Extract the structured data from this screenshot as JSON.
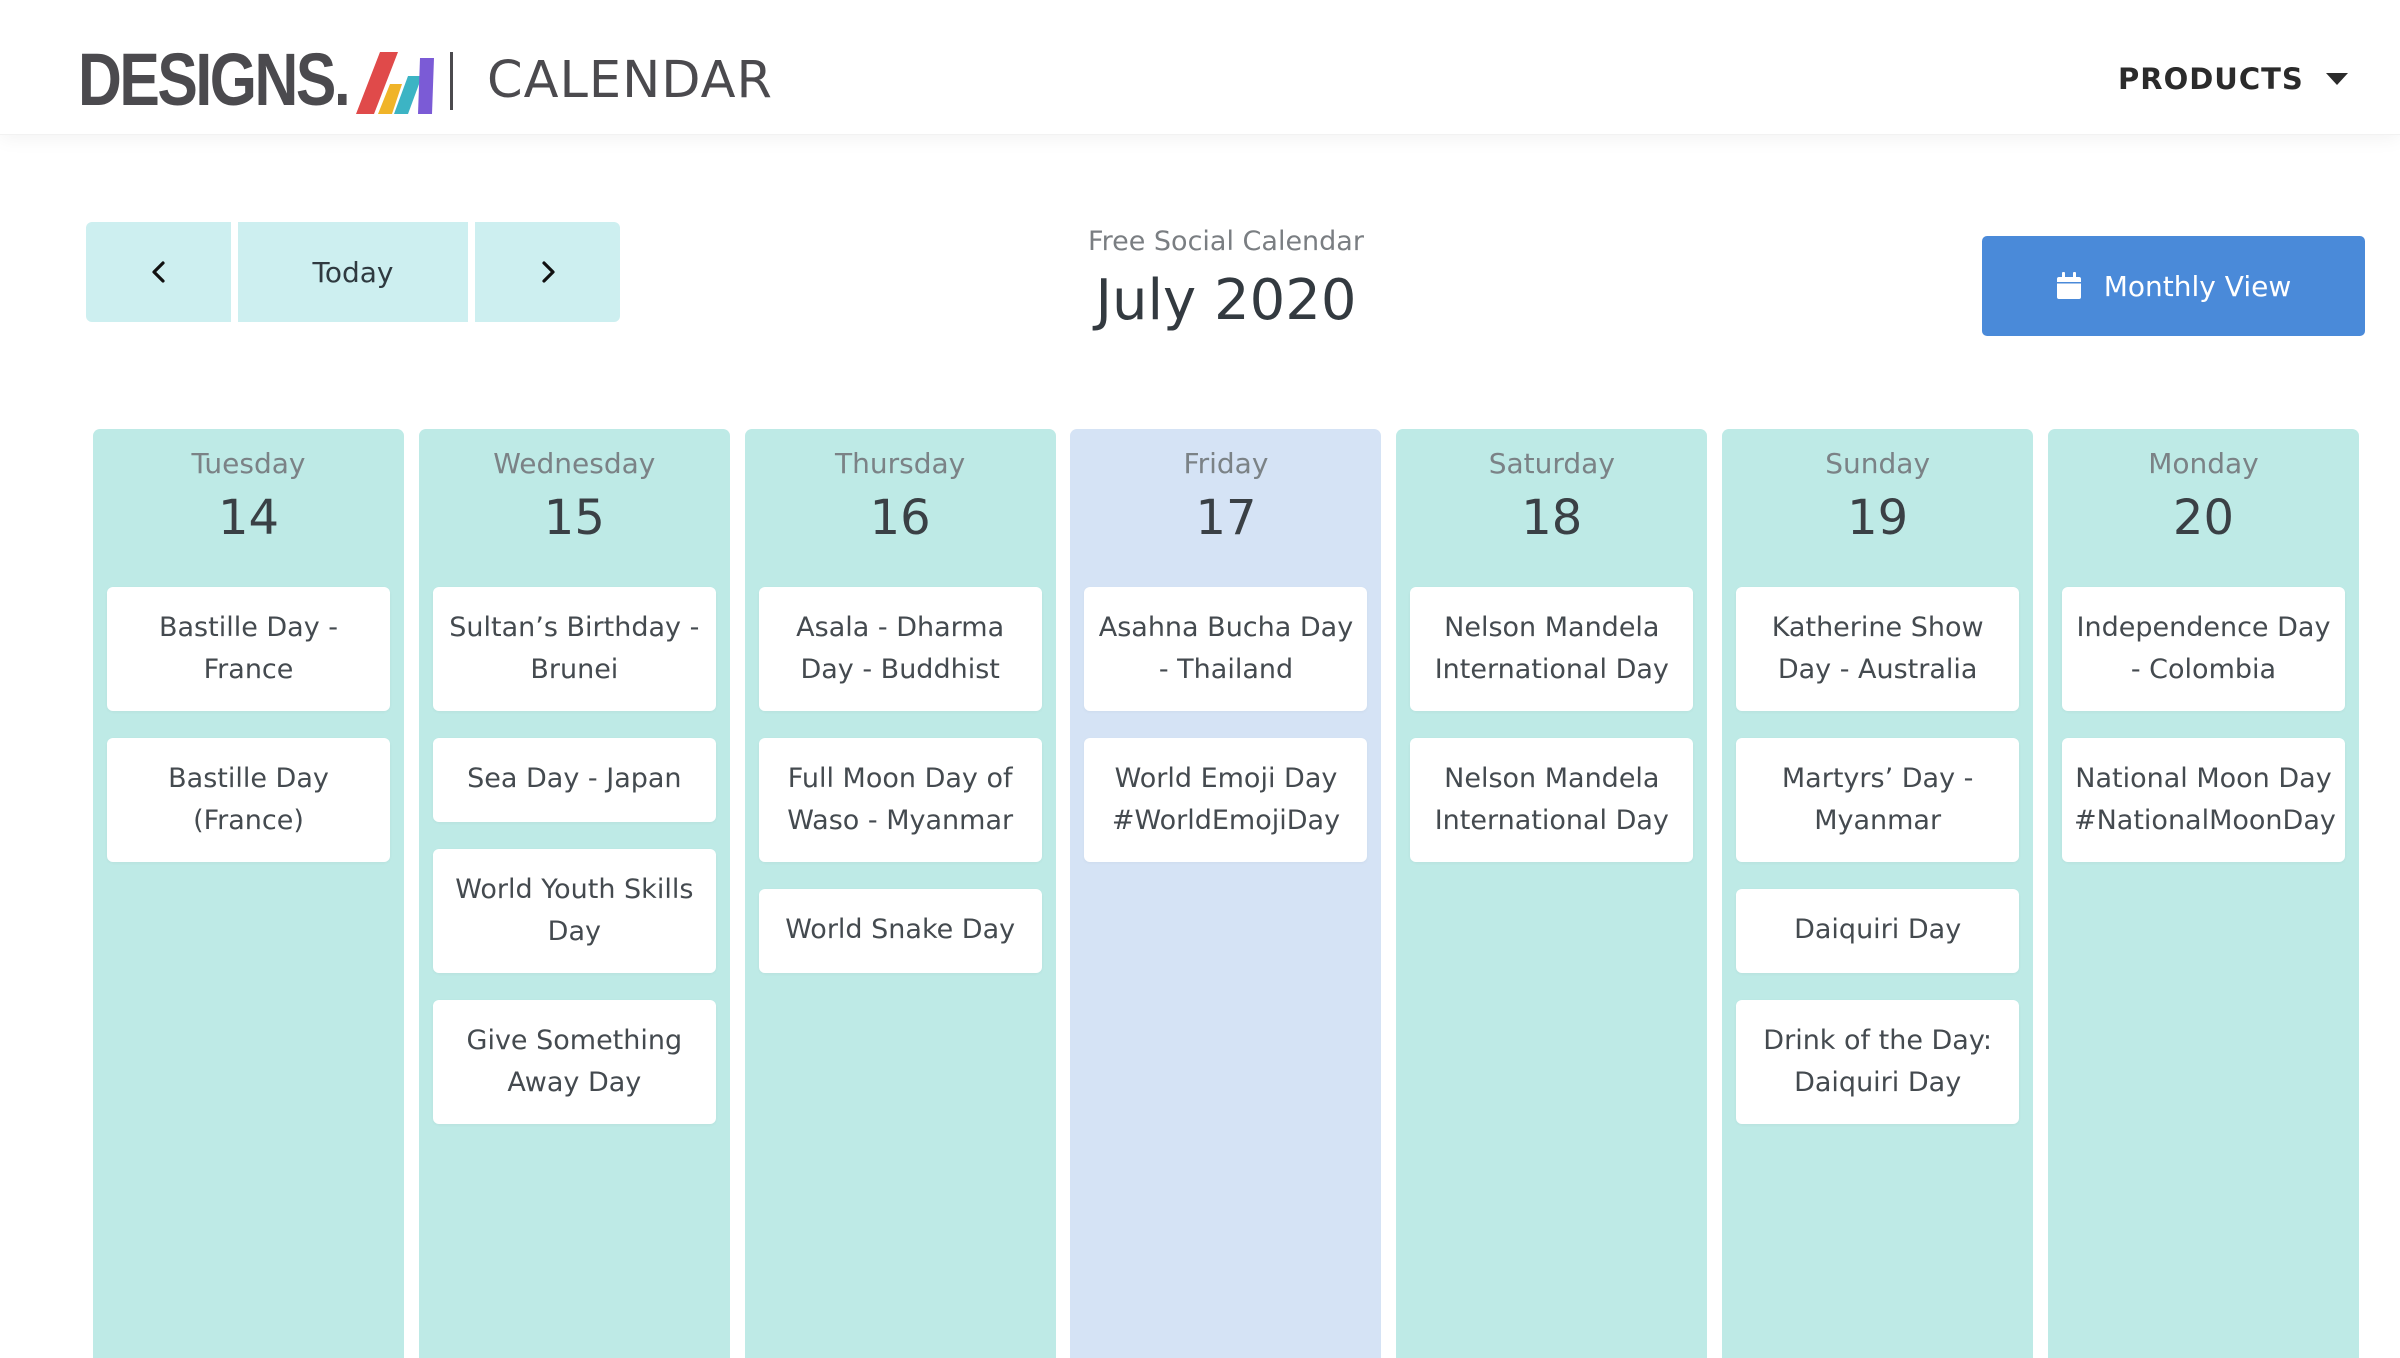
{
  "header": {
    "brand": "DESIGNS.",
    "brand_suffix": "AI",
    "section": "CALENDAR",
    "products_label": "PRODUCTS"
  },
  "toolbar": {
    "today_label": "Today",
    "subtitle": "Free Social Calendar",
    "month_title": "July 2020",
    "monthly_view_label": "Monthly View",
    "accent": "#4a8ad9"
  },
  "days": [
    {
      "name": "Tuesday",
      "number": "14",
      "events": [
        "Bastille Day - France",
        "Bastille Day (France)"
      ]
    },
    {
      "name": "Wednesday",
      "number": "15",
      "events": [
        "Sultan’s Birthday - Brunei",
        "Sea Day - Japan",
        "World Youth Skills Day",
        "Give Something Away Day"
      ]
    },
    {
      "name": "Thursday",
      "number": "16",
      "events": [
        "Asala - Dharma Day - Buddhist",
        "Full Moon Day of Waso - Myanmar",
        "World Snake Day"
      ]
    },
    {
      "name": "Friday",
      "number": "17",
      "is_today": true,
      "events": [
        "Asahna Bucha Day - Thailand",
        "World Emoji Day #WorldEmojiDay"
      ]
    },
    {
      "name": "Saturday",
      "number": "18",
      "events": [
        "Nelson Mandela International Day",
        "Nelson Mandela International Day"
      ]
    },
    {
      "name": "Sunday",
      "number": "19",
      "events": [
        "Katherine Show Day - Australia",
        "Martyrs’ Day - Myanmar",
        "Daiquiri Day",
        "Drink of the Day: Daiquiri Day"
      ]
    },
    {
      "name": "Monday",
      "number": "20",
      "events": [
        "Independence Day - Colombia",
        "National Moon Day #NationalMoonDay"
      ]
    }
  ],
  "colors": {
    "column": "#beeae6",
    "today_column": "#d5e3f5",
    "nav_button": "#cdeff0"
  },
  "icons": {
    "prev": "chevron-left-icon",
    "next": "chevron-right-icon",
    "products": "caret-down-icon",
    "monthly_view": "calendar-icon"
  }
}
